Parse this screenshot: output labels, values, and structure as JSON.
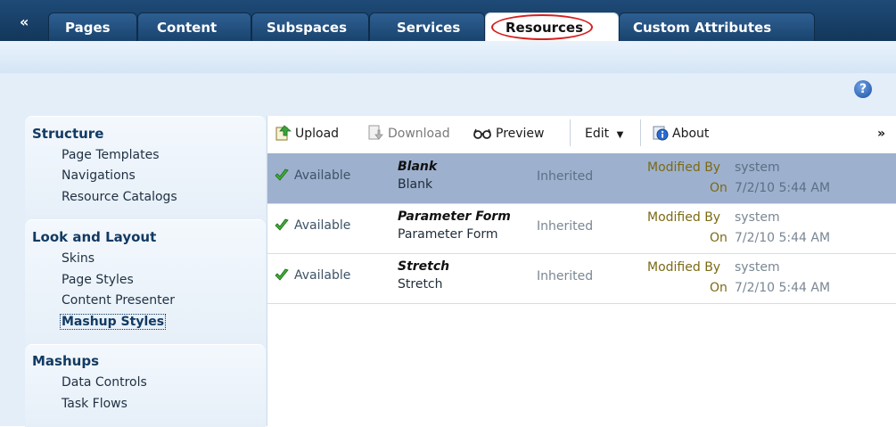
{
  "tabs": {
    "back_icon": "«",
    "items": [
      {
        "label": "Pages"
      },
      {
        "label": "Content"
      },
      {
        "label": "Subspaces"
      },
      {
        "label": "Services"
      },
      {
        "label": "Resources"
      },
      {
        "label": "Custom Attributes"
      }
    ],
    "active": "Resources"
  },
  "help_icon": "?",
  "nav": {
    "sections": [
      {
        "title": "Structure",
        "items": [
          "Page Templates",
          "Navigations",
          "Resource Catalogs"
        ]
      },
      {
        "title": "Look and Layout",
        "items": [
          "Skins",
          "Page Styles",
          "Content Presenter",
          "Mashup Styles"
        ]
      },
      {
        "title": "Mashups",
        "items": [
          "Data Controls",
          "Task Flows"
        ]
      }
    ],
    "selected": "Mashup Styles"
  },
  "toolbar": {
    "upload": "Upload",
    "download": "Download",
    "preview": "Preview",
    "edit": "Edit",
    "about": "About",
    "overflow_icon": "»"
  },
  "rows": [
    {
      "status": "Available",
      "title": "Blank",
      "subtitle": "Blank",
      "inherited": "Inherited",
      "modified_by_label": "Modified By",
      "modified_by": "system",
      "on_label": "On",
      "on": "7/2/10 5:44 AM"
    },
    {
      "status": "Available",
      "title": "Parameter Form",
      "subtitle": "Parameter Form",
      "inherited": "Inherited",
      "modified_by_label": "Modified By",
      "modified_by": "system",
      "on_label": "On",
      "on": "7/2/10 5:44 AM"
    },
    {
      "status": "Available",
      "title": "Stretch",
      "subtitle": "Stretch",
      "inherited": "Inherited",
      "modified_by_label": "Modified By",
      "modified_by": "system",
      "on_label": "On",
      "on": "7/2/10 5:44 AM"
    }
  ],
  "colors": {
    "tab_bar": "#1f4a78",
    "highlight_ring": "#d51f1f",
    "selected_row": "#9db0ce",
    "panel_bg": "#e3eef9"
  }
}
